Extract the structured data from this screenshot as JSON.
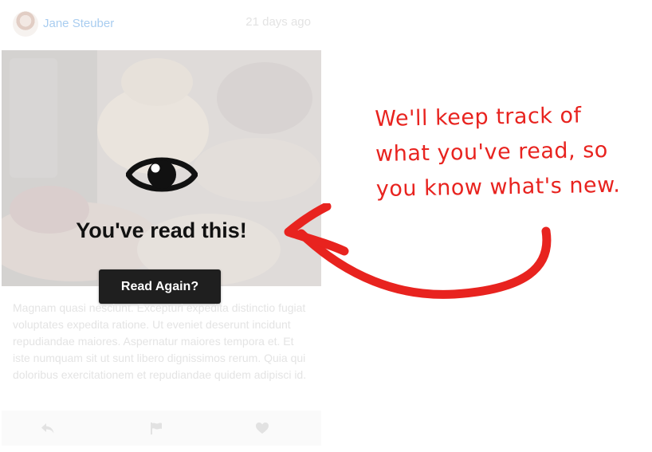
{
  "post": {
    "author": {
      "name": "Jane Steuber",
      "avatar_icon": "avatar-photo"
    },
    "timestamp": "21 days ago",
    "image_icon": "food-photo",
    "read_overlay": {
      "icon": "eye-icon",
      "title": "You've read this!",
      "button_label": "Read Again?"
    },
    "body_text": "Magnam quasi nesciunt. Excepturi expedita distinctio fugiat voluptates expedita ratione. Ut eveniet deserunt incidunt repudiandae maiores. Aspernatur maiores tempora et. Et iste numquam sit ut sunt libero dignissimos rerum. Quia qui doloribus exercitationem et repudiandae quidem adipisci id.",
    "actions": [
      {
        "icon": "reply-icon"
      },
      {
        "icon": "flag-icon"
      },
      {
        "icon": "heart-icon"
      }
    ]
  },
  "annotation": {
    "lines": [
      "We'll keep track of",
      "what you've read, so",
      "you know what's new."
    ],
    "arrow_icon": "red-arrow"
  },
  "colors": {
    "author_link": "#a9cdf0",
    "button_bg": "#1f1f1f",
    "annotation_red": "#e8231f"
  }
}
